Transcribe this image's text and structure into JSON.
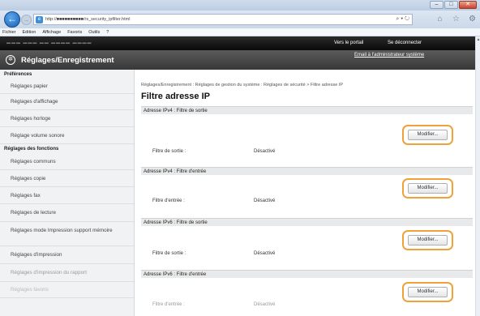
{
  "browser": {
    "address_text": "http://■■■■■■■■■■/rs_security_ipfilter.html",
    "address_tools": "⌕ ▾ ↻",
    "menu": [
      "Fichier",
      "Edition",
      "Affichage",
      "Favoris",
      "Outils",
      "?"
    ]
  },
  "header": {
    "portal_link": "Vers le portail",
    "logout_link": "Se déconnecter",
    "site_title": "Réglages/Enregistrement",
    "admin_email": "Email à l'administrateur système"
  },
  "sidebar": {
    "preferences_heading": "Préférences",
    "preferences": [
      "Réglages papier",
      "Réglages d'affichage",
      "Réglages horloge",
      "Réglage volume sonore"
    ],
    "functions_heading": "Réglages des fonctions",
    "functions": [
      "Réglages communs",
      "Réglages copie",
      "Réglages fax",
      "Réglages de lecture",
      "Réglages mode Impression support mémoire",
      "Réglages d'impression",
      "Réglages d'impression du rapport",
      "Réglages favoris"
    ]
  },
  "main": {
    "breadcrumb": "Réglages/Enregistrement : Réglages de gestion du système : Réglages de sécurité > Filtre adresse IP",
    "title": "Filtre adresse IP",
    "modify_label": "Modifier...",
    "sections": [
      {
        "header": "Adresse IPv4 : Filtre de sortie",
        "label": "Filtre de sortie :",
        "value": "Désactivé"
      },
      {
        "header": "Adresse IPv4 : Filtre d'entrée",
        "label": "Filtre d'entrée :",
        "value": "Désactivé"
      },
      {
        "header": "Adresse IPv6 : Filtre de sortie",
        "label": "Filtre de sortie :",
        "value": "Désactivé"
      },
      {
        "header": "Adresse IPv6 : Filtre d'entrée",
        "label": "Filtre d'entrée :",
        "value": "Désactivé"
      }
    ]
  },
  "colors": {
    "highlight": "#f0a23a",
    "header_black": "#111111",
    "header_gray": "#484848"
  }
}
